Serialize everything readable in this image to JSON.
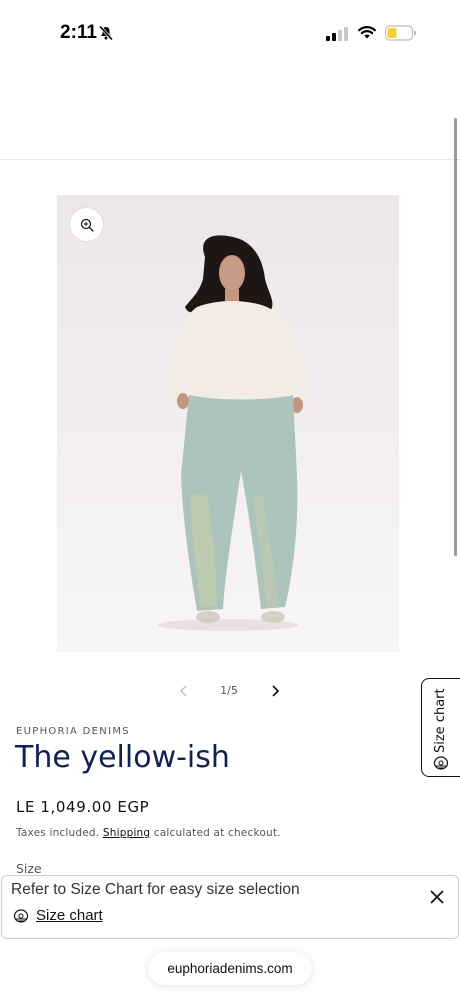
{
  "status_bar": {
    "time": "2:11",
    "icons": [
      "mute-icon",
      "signal-icon",
      "wifi-icon",
      "battery-icon"
    ]
  },
  "gallery": {
    "zoom_icon": "zoom-in-icon",
    "counter": "1/5",
    "prev_icon": "chevron-left-icon",
    "next_icon": "chevron-right-icon"
  },
  "side_tab": {
    "label": "Size chart",
    "icon": "tape-measure-icon"
  },
  "product": {
    "vendor": "EUPHORIA DENIMS",
    "title": "The yellow-ish",
    "price": "LE 1,049.00 EGP",
    "tax_prefix": "Taxes included.",
    "tax_link": "Shipping",
    "tax_suffix": "calculated at checkout.",
    "size_label": "Size"
  },
  "popup": {
    "message": "Refer to Size Chart for easy size selection",
    "link_label": "Size chart",
    "link_icon": "tape-measure-icon",
    "close_icon": "close-icon"
  },
  "browser": {
    "url": "euphoriadenims.com"
  },
  "colors": {
    "title": "#122152",
    "battery_fill": "#f2d233"
  }
}
